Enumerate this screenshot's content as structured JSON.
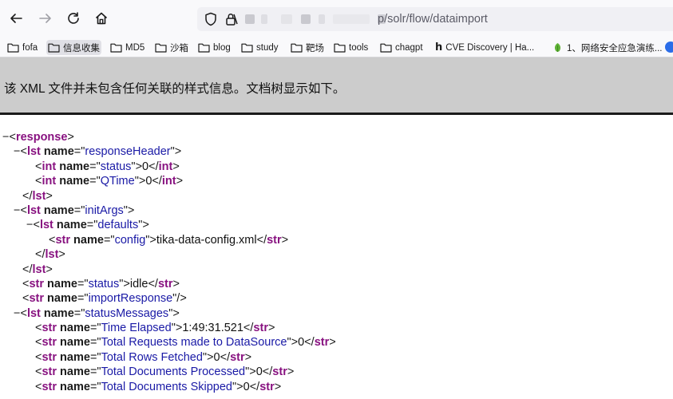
{
  "browser": {
    "url_path": "р/solr/flow/dataimport",
    "bookmarks": [
      {
        "label": "fofa",
        "icon": "folder-icon"
      },
      {
        "label": "信息收集",
        "icon": "folder-icon"
      },
      {
        "label": "MD5",
        "icon": "folder-icon"
      },
      {
        "label": "沙箱",
        "icon": "folder-icon"
      },
      {
        "label": "blog",
        "icon": "folder-icon"
      },
      {
        "label": "study",
        "icon": "folder-icon"
      },
      {
        "label": "靶场",
        "icon": "folder-icon"
      },
      {
        "label": "tools",
        "icon": "folder-icon"
      },
      {
        "label": "chagpt",
        "icon": "folder-icon"
      },
      {
        "label": "CVE Discovery | Ha...",
        "icon": "site-logo-icon"
      },
      {
        "label": "1、网络安全应急演练...",
        "icon": "site-logo-icon"
      }
    ],
    "colors": {
      "chrome": "#f9f9fb",
      "url_bar": "#f0f0f4",
      "active_bookmark": "#e0e0e6"
    }
  },
  "page": {
    "header_message": "该 XML 文件并未包含任何关联的样式信息。文档树显示如下。",
    "colors": {
      "header_bg": "#cccccc",
      "tag": "#881280",
      "attr_value": "#1a1aa6"
    },
    "xml": {
      "toggle": "−",
      "root_tag": "response",
      "response_header": {
        "tag": "lst",
        "attr": "name",
        "name": "responseHeader"
      },
      "status": {
        "tag": "int",
        "attr": "name",
        "name": "status",
        "value": "0"
      },
      "qtime": {
        "tag": "int",
        "attr": "name",
        "name": "QTime",
        "value": "0"
      },
      "init_args": {
        "tag": "lst",
        "attr": "name",
        "name": "initArgs"
      },
      "defaults": {
        "tag": "lst",
        "attr": "name",
        "name": "defaults"
      },
      "config": {
        "tag": "str",
        "attr": "name",
        "name": "config",
        "value": "tika-data-config.xml"
      },
      "import_status": {
        "tag": "str",
        "attr": "name",
        "name": "status",
        "value": "idle"
      },
      "import_response": {
        "tag": "str",
        "attr": "name",
        "name": "importResponse"
      },
      "status_messages": {
        "tag": "lst",
        "attr": "name",
        "name": "statusMessages"
      },
      "messages": [
        {
          "tag": "str",
          "attr": "name",
          "name": "Time Elapsed",
          "value": "1:49:31.521"
        },
        {
          "tag": "str",
          "attr": "name",
          "name": "Total Requests made to DataSource",
          "value": "0"
        },
        {
          "tag": "str",
          "attr": "name",
          "name": "Total Rows Fetched",
          "value": "0"
        },
        {
          "tag": "str",
          "attr": "name",
          "name": "Total Documents Processed",
          "value": "0"
        },
        {
          "tag": "str",
          "attr": "name",
          "name": "Total Documents Skipped",
          "value": "0"
        }
      ]
    }
  }
}
